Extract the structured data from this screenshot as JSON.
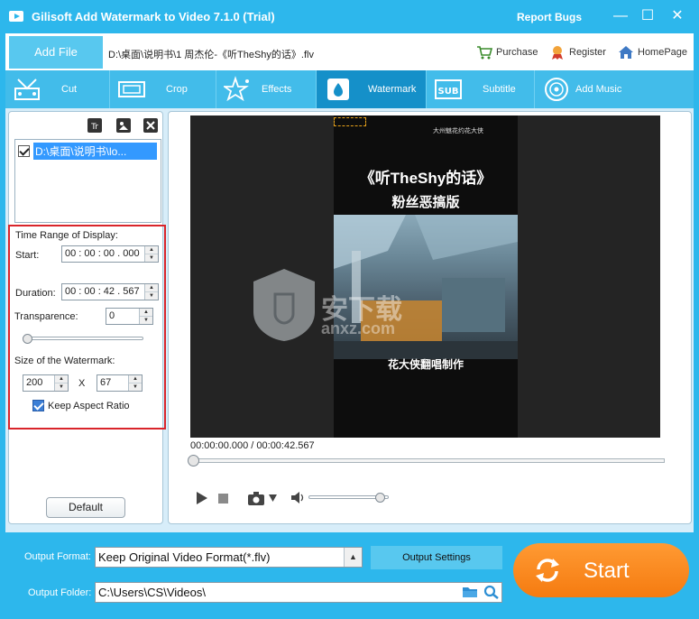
{
  "window": {
    "title": "Gilisoft Add Watermark to Video 7.1.0 (Trial)",
    "report_bugs": "Report Bugs",
    "minimize": "—",
    "maximize": "☐",
    "close": "✕"
  },
  "topbar": {
    "add_file": "Add File",
    "file_path": "D:\\桌面\\说明书\\1 周杰伦-《听TheShy的话》.flv",
    "purchase": "Purchase",
    "register": "Register",
    "homepage": "HomePage"
  },
  "tabs": [
    {
      "label": "Cut",
      "icon": "cut-icon"
    },
    {
      "label": "Crop",
      "icon": "crop-icon"
    },
    {
      "label": "Effects",
      "icon": "effects-icon"
    },
    {
      "label": "Watermark",
      "icon": "watermark-icon",
      "active": true
    },
    {
      "label": "Subtitle",
      "icon": "subtitle-icon"
    },
    {
      "label": "Add Music",
      "icon": "music-icon"
    }
  ],
  "watermark_list": {
    "items": [
      "D:\\桌面\\说明书\\lo..."
    ]
  },
  "settings": {
    "time_range_label": "Time Range of Display:",
    "start_label": "Start:",
    "start_value": "00 : 00 : 00 . 000",
    "duration_label": "Duration:",
    "duration_value": "00 : 00 : 42 . 567",
    "transparence_label": "Transparence:",
    "transparence_value": "0",
    "transparence_level": 0,
    "size_label": "Size of the Watermark:",
    "width_value": "200",
    "x_label": "X",
    "height_value": "67",
    "keep_aspect_label": "Keep Aspect Ratio",
    "default_button": "Default"
  },
  "video": {
    "title_line1": "《听TheShy的话》",
    "title_line2": "粉丝恶搞版",
    "caption": "花大侠翻唱制作",
    "corner_text": "大州魅花约花大侠",
    "time_display": "00:00:00.000 / 00:00:42.567",
    "progress": 0,
    "volume": 0.9,
    "site_watermark": "安下载",
    "site_watermark_sub": "anxz.com"
  },
  "bottom": {
    "output_format_label": "Output Format:",
    "output_format_value": "Keep Original Video Format(*.flv)",
    "output_settings": "Output Settings",
    "output_folder_label": "Output Folder:",
    "output_folder_value": "C:\\Users\\CS\\Videos\\",
    "start": "Start"
  },
  "colors": {
    "brand_blue": "#2db7ec",
    "active_tab": "#1590c9",
    "start_orange": "#f68b1f",
    "highlight_red": "#d9252b"
  }
}
